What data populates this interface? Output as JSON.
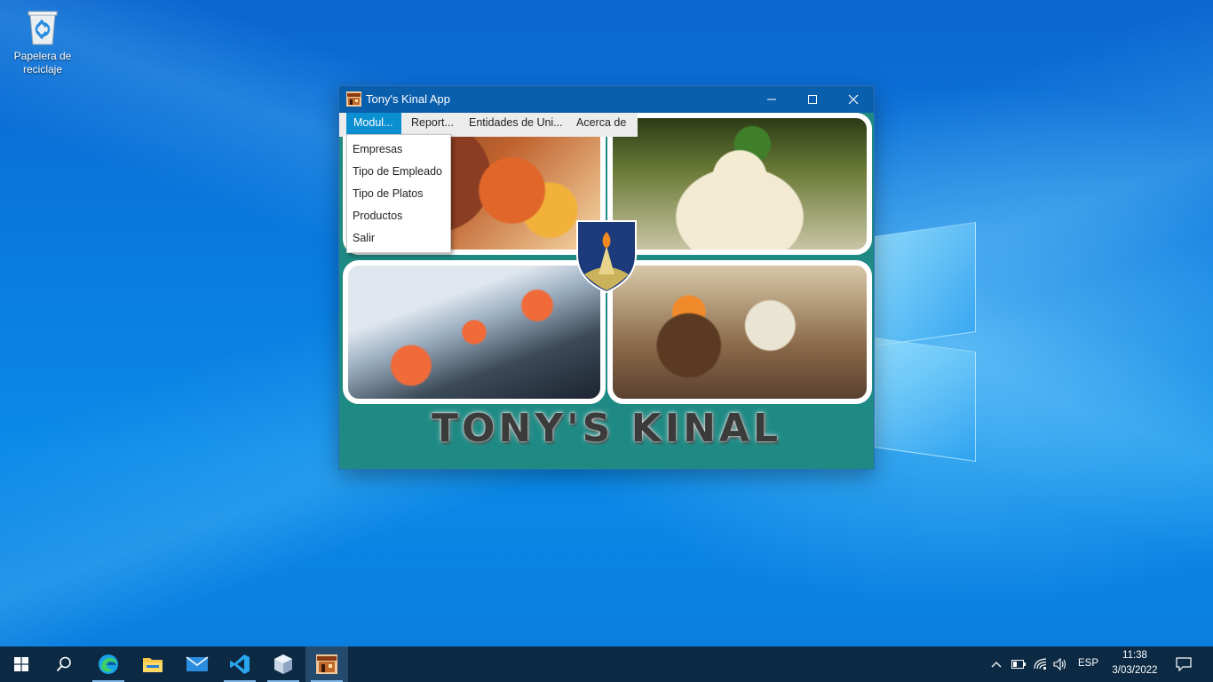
{
  "desktop": {
    "icons": [
      {
        "label": "Papelera de reciclaje",
        "icon": "recycle-bin-icon"
      }
    ]
  },
  "window": {
    "title": "Tony's Kinal App",
    "icon": "restaurant-app-icon",
    "controls": [
      "minimize-icon",
      "maximize-icon",
      "close-icon"
    ]
  },
  "menubar": {
    "items": [
      {
        "label": "Modul...",
        "active": true
      },
      {
        "label": "Report...",
        "active": false
      },
      {
        "label": "Entidades de Uni...",
        "active": false
      },
      {
        "label": "Acerca de",
        "active": false
      }
    ]
  },
  "dropdown": {
    "items": [
      {
        "label": "Empresas"
      },
      {
        "label": "Tipo de Empleado"
      },
      {
        "label": "Tipo de Platos"
      },
      {
        "label": "Productos"
      },
      {
        "label": "Salir"
      }
    ]
  },
  "content": {
    "brand": "TONY'S KINAL",
    "photos": [
      "grilled-salmon-dish",
      "white-fish-dish",
      "salmon-spoons-appetizer",
      "canape-appetizers"
    ],
    "crest": "torch-crest-logo"
  },
  "taskbar": {
    "apps": [
      "start-icon",
      "search-icon",
      "edge-icon",
      "file-explorer-icon",
      "mail-icon",
      "vscode-icon",
      "cube-app-icon",
      "tonys-kinal-app-icon"
    ],
    "tray": {
      "language": "ESP",
      "time": "11:38",
      "date": "3/03/2022"
    }
  },
  "colors": {
    "titlebar": "#0a5fad",
    "menu_active": "#0a8fd1",
    "app_background": "#1f8a84",
    "taskbar": "#0d2a44"
  }
}
